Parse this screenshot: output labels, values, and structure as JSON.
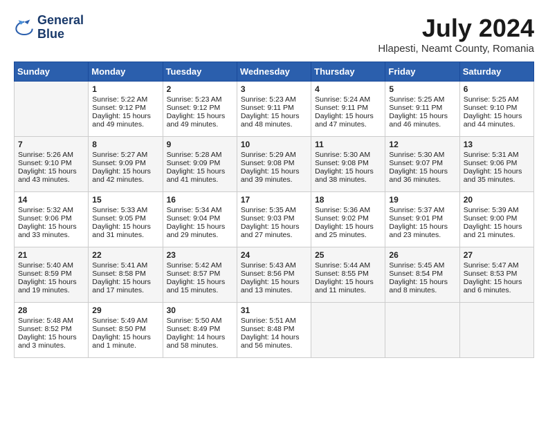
{
  "header": {
    "logo_line1": "General",
    "logo_line2": "Blue",
    "month_year": "July 2024",
    "location": "Hlapesti, Neamt County, Romania"
  },
  "days_of_week": [
    "Sunday",
    "Monday",
    "Tuesday",
    "Wednesday",
    "Thursday",
    "Friday",
    "Saturday"
  ],
  "weeks": [
    [
      {
        "day": "",
        "empty": true
      },
      {
        "day": "1",
        "sunrise": "5:22 AM",
        "sunset": "9:12 PM",
        "daylight": "15 hours and 49 minutes."
      },
      {
        "day": "2",
        "sunrise": "5:23 AM",
        "sunset": "9:12 PM",
        "daylight": "15 hours and 49 minutes."
      },
      {
        "day": "3",
        "sunrise": "5:23 AM",
        "sunset": "9:11 PM",
        "daylight": "15 hours and 48 minutes."
      },
      {
        "day": "4",
        "sunrise": "5:24 AM",
        "sunset": "9:11 PM",
        "daylight": "15 hours and 47 minutes."
      },
      {
        "day": "5",
        "sunrise": "5:25 AM",
        "sunset": "9:11 PM",
        "daylight": "15 hours and 46 minutes."
      },
      {
        "day": "6",
        "sunrise": "5:25 AM",
        "sunset": "9:10 PM",
        "daylight": "15 hours and 44 minutes."
      }
    ],
    [
      {
        "day": "7",
        "sunrise": "5:26 AM",
        "sunset": "9:10 PM",
        "daylight": "15 hours and 43 minutes."
      },
      {
        "day": "8",
        "sunrise": "5:27 AM",
        "sunset": "9:09 PM",
        "daylight": "15 hours and 42 minutes."
      },
      {
        "day": "9",
        "sunrise": "5:28 AM",
        "sunset": "9:09 PM",
        "daylight": "15 hours and 41 minutes."
      },
      {
        "day": "10",
        "sunrise": "5:29 AM",
        "sunset": "9:08 PM",
        "daylight": "15 hours and 39 minutes."
      },
      {
        "day": "11",
        "sunrise": "5:30 AM",
        "sunset": "9:08 PM",
        "daylight": "15 hours and 38 minutes."
      },
      {
        "day": "12",
        "sunrise": "5:30 AM",
        "sunset": "9:07 PM",
        "daylight": "15 hours and 36 minutes."
      },
      {
        "day": "13",
        "sunrise": "5:31 AM",
        "sunset": "9:06 PM",
        "daylight": "15 hours and 35 minutes."
      }
    ],
    [
      {
        "day": "14",
        "sunrise": "5:32 AM",
        "sunset": "9:06 PM",
        "daylight": "15 hours and 33 minutes."
      },
      {
        "day": "15",
        "sunrise": "5:33 AM",
        "sunset": "9:05 PM",
        "daylight": "15 hours and 31 minutes."
      },
      {
        "day": "16",
        "sunrise": "5:34 AM",
        "sunset": "9:04 PM",
        "daylight": "15 hours and 29 minutes."
      },
      {
        "day": "17",
        "sunrise": "5:35 AM",
        "sunset": "9:03 PM",
        "daylight": "15 hours and 27 minutes."
      },
      {
        "day": "18",
        "sunrise": "5:36 AM",
        "sunset": "9:02 PM",
        "daylight": "15 hours and 25 minutes."
      },
      {
        "day": "19",
        "sunrise": "5:37 AM",
        "sunset": "9:01 PM",
        "daylight": "15 hours and 23 minutes."
      },
      {
        "day": "20",
        "sunrise": "5:39 AM",
        "sunset": "9:00 PM",
        "daylight": "15 hours and 21 minutes."
      }
    ],
    [
      {
        "day": "21",
        "sunrise": "5:40 AM",
        "sunset": "8:59 PM",
        "daylight": "15 hours and 19 minutes."
      },
      {
        "day": "22",
        "sunrise": "5:41 AM",
        "sunset": "8:58 PM",
        "daylight": "15 hours and 17 minutes."
      },
      {
        "day": "23",
        "sunrise": "5:42 AM",
        "sunset": "8:57 PM",
        "daylight": "15 hours and 15 minutes."
      },
      {
        "day": "24",
        "sunrise": "5:43 AM",
        "sunset": "8:56 PM",
        "daylight": "15 hours and 13 minutes."
      },
      {
        "day": "25",
        "sunrise": "5:44 AM",
        "sunset": "8:55 PM",
        "daylight": "15 hours and 11 minutes."
      },
      {
        "day": "26",
        "sunrise": "5:45 AM",
        "sunset": "8:54 PM",
        "daylight": "15 hours and 8 minutes."
      },
      {
        "day": "27",
        "sunrise": "5:47 AM",
        "sunset": "8:53 PM",
        "daylight": "15 hours and 6 minutes."
      }
    ],
    [
      {
        "day": "28",
        "sunrise": "5:48 AM",
        "sunset": "8:52 PM",
        "daylight": "15 hours and 3 minutes."
      },
      {
        "day": "29",
        "sunrise": "5:49 AM",
        "sunset": "8:50 PM",
        "daylight": "15 hours and 1 minute."
      },
      {
        "day": "30",
        "sunrise": "5:50 AM",
        "sunset": "8:49 PM",
        "daylight": "14 hours and 58 minutes."
      },
      {
        "day": "31",
        "sunrise": "5:51 AM",
        "sunset": "8:48 PM",
        "daylight": "14 hours and 56 minutes."
      },
      {
        "day": "",
        "empty": true
      },
      {
        "day": "",
        "empty": true
      },
      {
        "day": "",
        "empty": true
      }
    ]
  ]
}
